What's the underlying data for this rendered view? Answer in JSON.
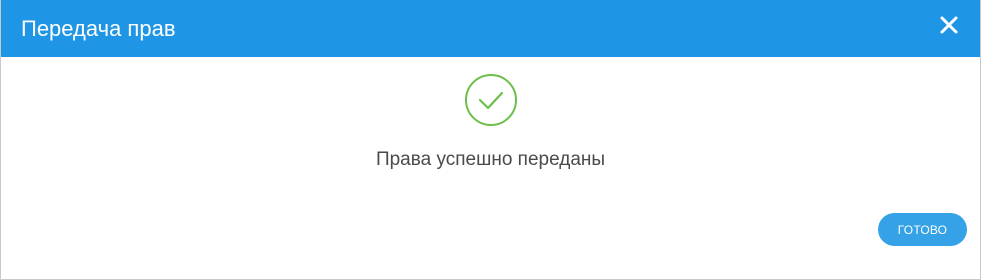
{
  "dialog": {
    "title": "Передача прав",
    "close_icon": "close-icon",
    "success_icon": "checkmark-circle-icon",
    "message": "Права успешно переданы",
    "done_label": "ГОТОВО"
  },
  "colors": {
    "header_bg": "#1f96e5",
    "button_bg": "#35a2e8",
    "success_green": "#6cbf4a",
    "message_text": "#4a4a4a"
  }
}
